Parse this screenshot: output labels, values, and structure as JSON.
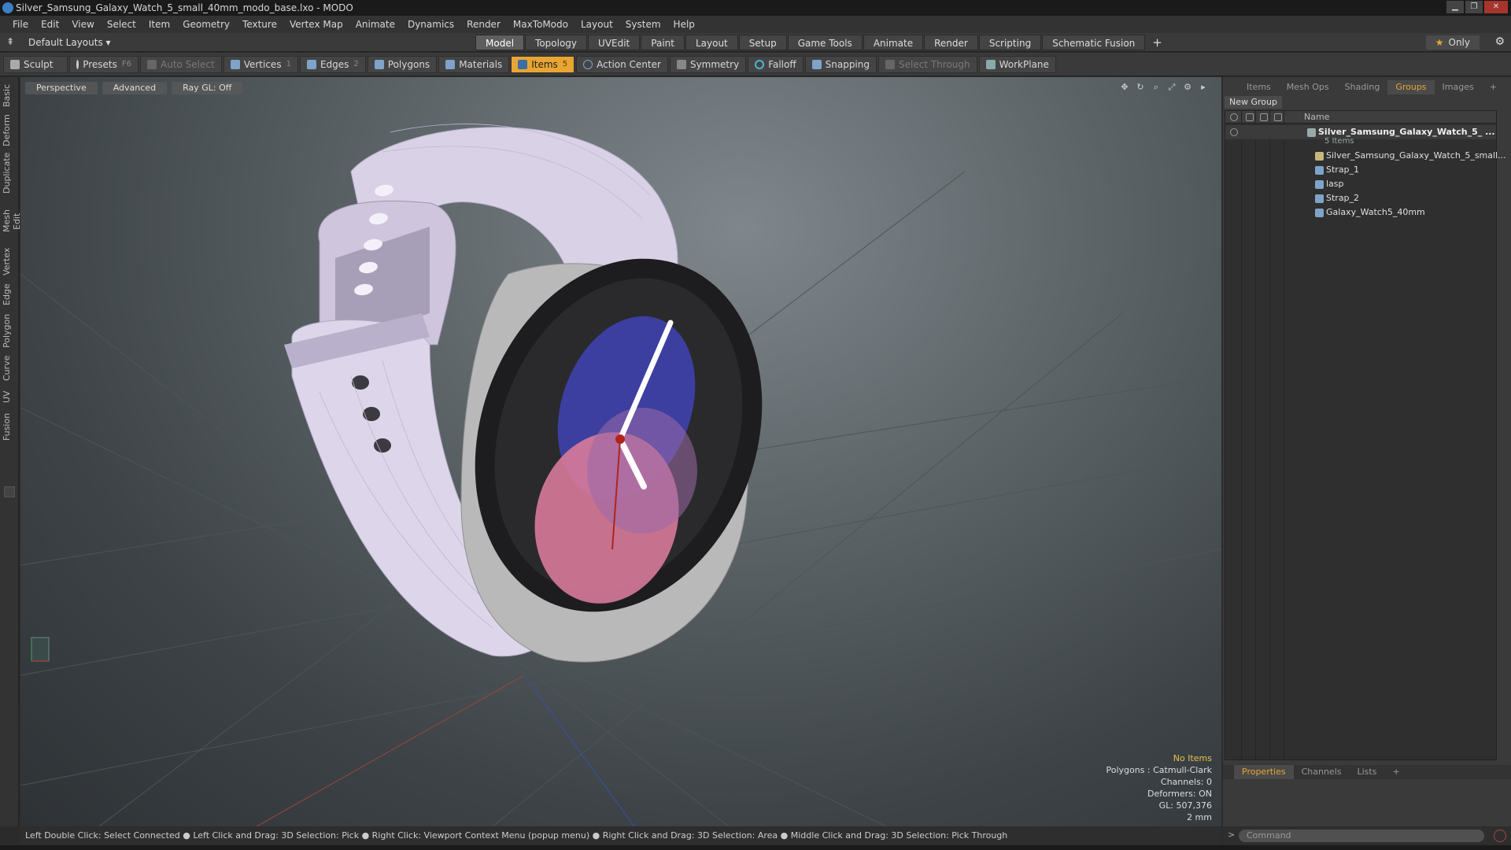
{
  "window": {
    "title": "Silver_Samsung_Galaxy_Watch_5_small_40mm_modo_base.lxo - MODO",
    "minimize": "▁",
    "maximize": "❐",
    "close": "✕"
  },
  "menu": [
    "File",
    "Edit",
    "View",
    "Select",
    "Item",
    "Geometry",
    "Texture",
    "Vertex Map",
    "Animate",
    "Dynamics",
    "Render",
    "MaxToModo",
    "Layout",
    "System",
    "Help"
  ],
  "layout": {
    "selector": "Default Layouts ▾",
    "tabs": [
      "Model",
      "Topology",
      "UVEdit",
      "Paint",
      "Layout",
      "Setup",
      "Game Tools",
      "Animate",
      "Render",
      "Scripting",
      "Schematic Fusion"
    ],
    "active_tab": "Model",
    "add": "+",
    "only": "Only",
    "star": "★",
    "gear": "⚙"
  },
  "toolbar": {
    "sculpt": "Sculpt",
    "presets": "Presets",
    "presets_key": "F6",
    "auto_select": "Auto Select",
    "vertices": "Vertices",
    "vertices_key": "1",
    "edges": "Edges",
    "edges_key": "2",
    "polygons": "Polygons",
    "materials": "Materials",
    "items": "Items",
    "items_key": "5",
    "action_center": "Action Center",
    "symmetry": "Symmetry",
    "falloff": "Falloff",
    "snapping": "Snapping",
    "select_through": "Select Through",
    "workplane": "WorkPlane"
  },
  "left_tabs": [
    "Basic",
    "Deform",
    "Duplicate",
    "Mesh Edit",
    "Vertex",
    "Edge",
    "Polygon",
    "Curve",
    "UV",
    "Fusion"
  ],
  "viewport": {
    "view": "Perspective",
    "shading": "Advanced",
    "raygl": "Ray GL: Off",
    "info": {
      "selection": "No Items",
      "polygons": "Polygons : Catmull-Clark",
      "channels": "Channels: 0",
      "deformers": "Deformers: ON",
      "gl": "GL: 507,376",
      "unit": "2 mm"
    }
  },
  "right_panel": {
    "tabs": [
      "Items",
      "Mesh Ops",
      "Shading",
      "Groups",
      "Images"
    ],
    "active_tab": "Groups",
    "add": "+",
    "new_group": "New Group",
    "name_col": "Name",
    "group": {
      "name": "Silver_Samsung_Galaxy_Watch_5_ ...",
      "count": "5 Items",
      "children": [
        "Silver_Samsung_Galaxy_Watch_5_small...",
        "Strap_1",
        "lasp",
        "Strap_2",
        "Galaxy_Watch5_40mm"
      ]
    },
    "props_tabs": [
      "Properties",
      "Channels",
      "Lists"
    ],
    "props_active": "Properties"
  },
  "status": "Left Double Click: Select Connected ● Left Click and Drag: 3D Selection: Pick ● Right Click: Viewport Context Menu (popup menu) ● Right Click and Drag: 3D Selection: Area ● Middle Click and Drag: 3D Selection: Pick Through",
  "command_placeholder": "Command",
  "colors": {
    "accent": "#e8a534",
    "strap": "#d9d2e6",
    "case": "#b9b9b9",
    "face_blue": "#3c3fa0",
    "face_pink": "#d77a9a"
  }
}
